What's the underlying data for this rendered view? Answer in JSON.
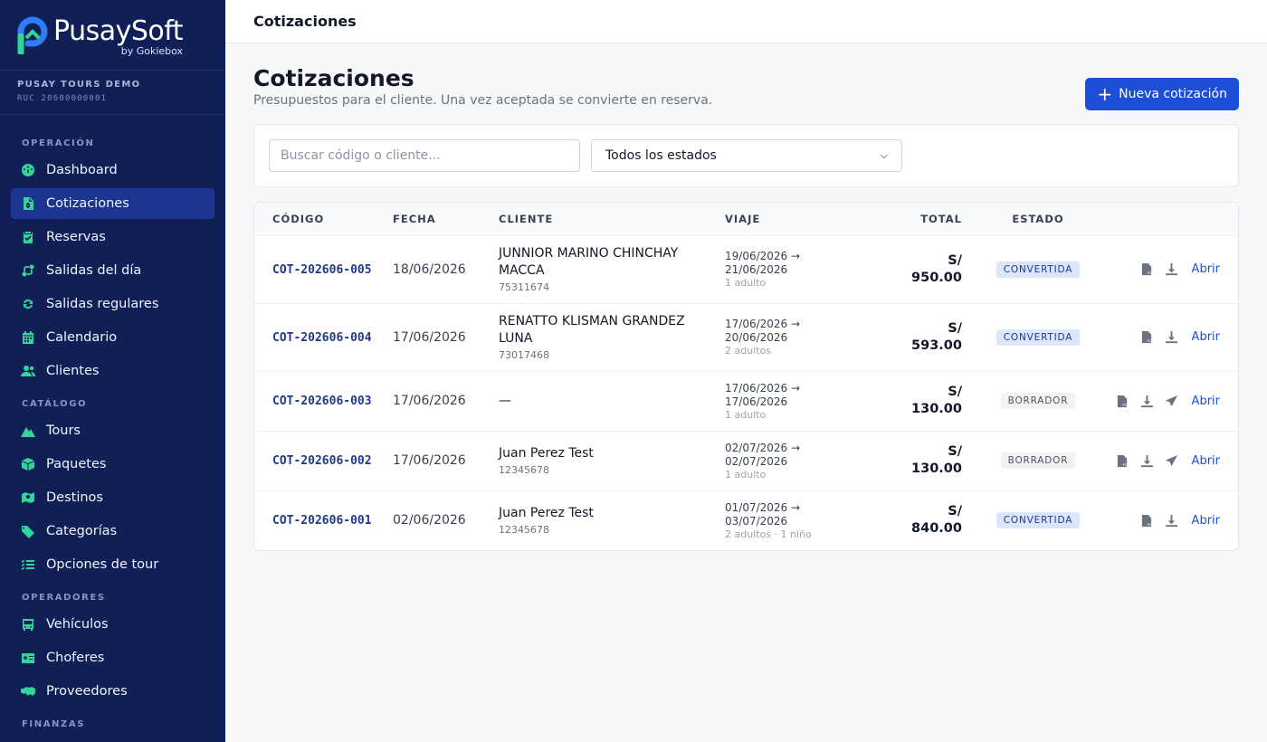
{
  "brand": {
    "name": "PusaySoft",
    "by": "by Gokiebox"
  },
  "company": {
    "name": "PUSAY TOURS DEMO",
    "ruc": "RUC 20600000001"
  },
  "sidebar": {
    "sections": [
      {
        "label": "OPERACIÓN",
        "items": [
          {
            "label": "Dashboard",
            "icon": "gauge-icon"
          },
          {
            "label": "Cotizaciones",
            "icon": "file-dollar-icon",
            "active": true
          },
          {
            "label": "Reservas",
            "icon": "clipboard-check-icon"
          },
          {
            "label": "Salidas del día",
            "icon": "route-icon"
          },
          {
            "label": "Salidas regulares",
            "icon": "repeat-icon"
          },
          {
            "label": "Calendario",
            "icon": "calendar-icon"
          },
          {
            "label": "Clientes",
            "icon": "users-icon"
          }
        ]
      },
      {
        "label": "CATÁLOGO",
        "items": [
          {
            "label": "Tours",
            "icon": "mountain-icon"
          },
          {
            "label": "Paquetes",
            "icon": "box-icon"
          },
          {
            "label": "Destinos",
            "icon": "map-pin-icon"
          },
          {
            "label": "Categorías",
            "icon": "tags-icon"
          },
          {
            "label": "Opciones de tour",
            "icon": "list-check-icon"
          }
        ]
      },
      {
        "label": "OPERADORES",
        "items": [
          {
            "label": "Vehículos",
            "icon": "bus-icon"
          },
          {
            "label": "Choferes",
            "icon": "id-card-icon"
          },
          {
            "label": "Proveedores",
            "icon": "handshake-icon"
          }
        ]
      },
      {
        "label": "FINANZAS",
        "items": []
      }
    ]
  },
  "topbar": {
    "title": "Cotizaciones"
  },
  "page": {
    "title": "Cotizaciones",
    "subtitle": "Presupuestos para el cliente. Una vez aceptada se convierte en reserva.",
    "new_button": "Nueva cotización"
  },
  "filters": {
    "search_placeholder": "Buscar código o cliente...",
    "status_value": "Todos los estados"
  },
  "table": {
    "headers": {
      "code": "CÓDIGO",
      "date": "FECHA",
      "client": "CLIENTE",
      "trip": "VIAJE",
      "total": "TOTAL",
      "state": "ESTADO"
    },
    "open_label": "Abrir",
    "rows": [
      {
        "code": "COT-202606-005",
        "date": "18/06/2026",
        "client": "JUNNIOR MARINO CHINCHAY MACCA",
        "doc": "75311674",
        "trip_from": "19/06/2026 →",
        "trip_to": "21/06/2026",
        "pax": "1 adulto",
        "currency": "S/",
        "amount": "950.00",
        "state": "CONVERTIDA",
        "send": false
      },
      {
        "code": "COT-202606-004",
        "date": "17/06/2026",
        "client": "RENATTO KLISMAN GRANDEZ LUNA",
        "doc": "73017468",
        "trip_from": "17/06/2026 →",
        "trip_to": "20/06/2026",
        "pax": "2 adultos",
        "currency": "S/",
        "amount": "593.00",
        "state": "CONVERTIDA",
        "send": false
      },
      {
        "code": "COT-202606-003",
        "date": "17/06/2026",
        "client": "—",
        "doc": "",
        "trip_from": "17/06/2026 →",
        "trip_to": "17/06/2026",
        "pax": "1 adulto",
        "currency": "S/",
        "amount": "130.00",
        "state": "BORRADOR",
        "send": true
      },
      {
        "code": "COT-202606-002",
        "date": "17/06/2026",
        "client": "Juan Perez Test",
        "doc": "12345678",
        "trip_from": "02/07/2026 →",
        "trip_to": "02/07/2026",
        "pax": "1 adulto",
        "currency": "S/",
        "amount": "130.00",
        "state": "BORRADOR",
        "send": true
      },
      {
        "code": "COT-202606-001",
        "date": "02/06/2026",
        "client": "Juan Perez Test",
        "doc": "12345678",
        "trip_from": "01/07/2026 →",
        "trip_to": "03/07/2026",
        "pax": "2 adultos · 1 niño",
        "currency": "S/",
        "amount": "840.00",
        "state": "CONVERTIDA",
        "send": false
      }
    ]
  },
  "colors": {
    "sidebar": "#102057",
    "accent": "#1d4ed8",
    "icon_green": "#34d399"
  }
}
